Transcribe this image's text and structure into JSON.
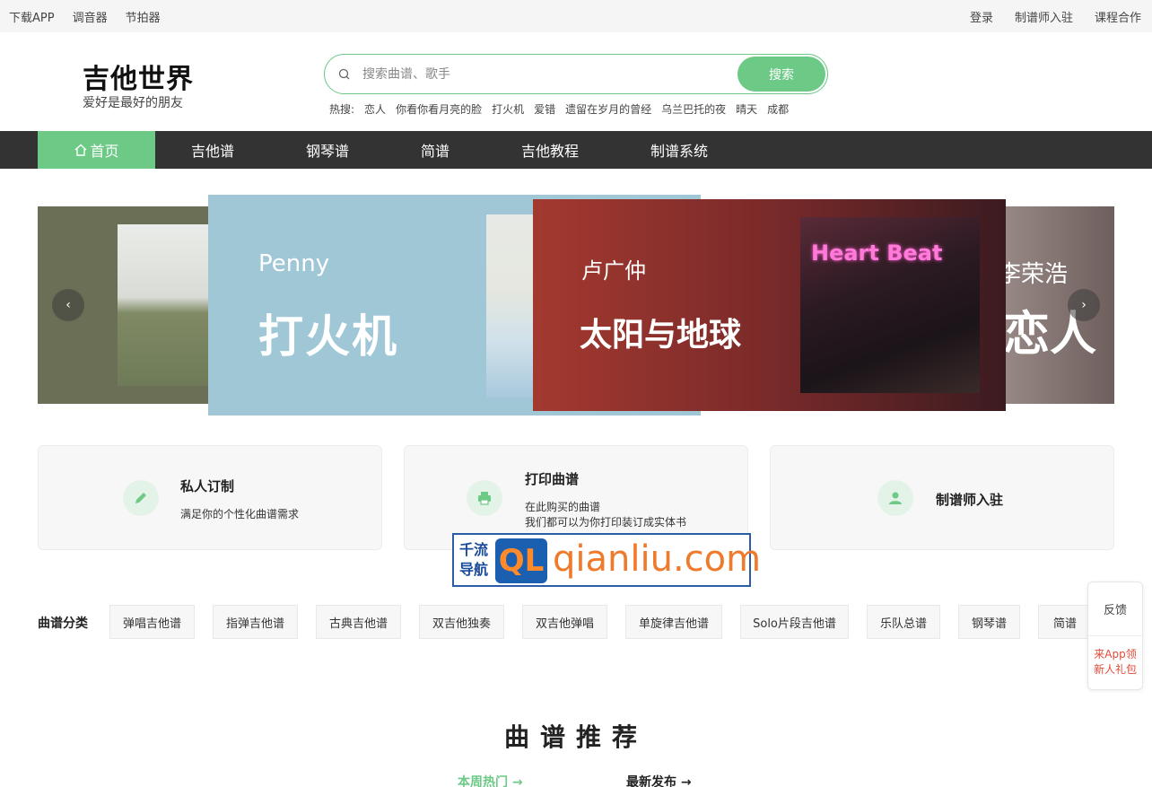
{
  "topbar": {
    "left": [
      "下载APP",
      "调音器",
      "节拍器"
    ],
    "right": [
      "登录",
      "制谱师入驻",
      "课程合作"
    ]
  },
  "header": {
    "logo": "吉他世界",
    "slogan": "爱好是最好的朋友",
    "search_placeholder": "搜索曲谱、歌手",
    "search_button": "搜索",
    "hot_label": "热搜:",
    "hot_items": [
      "恋人",
      "你看你看月亮的脸",
      "打火机",
      "爱错",
      "遗留在岁月的曾经",
      "乌兰巴托的夜",
      "晴天",
      "成都"
    ]
  },
  "nav": {
    "items": [
      "首页",
      "吉他谱",
      "钢琴谱",
      "简谱",
      "吉他教程",
      "制谱系统"
    ],
    "active": "首页"
  },
  "carousel": {
    "slides": [
      {
        "artist": "Penny",
        "song": "打火机"
      },
      {
        "artist": "卢广仲",
        "song": "太阳与地球"
      },
      {
        "artist": "李荣浩",
        "song": "恋人"
      }
    ],
    "neon_text": "Heart Beat"
  },
  "features": [
    {
      "title": "私人订制",
      "desc": [
        "满足你的个性化曲谱需求"
      ]
    },
    {
      "title": "打印曲谱",
      "desc": [
        "在此购买的曲谱",
        "我们都可以为你打印装订成实体书"
      ]
    },
    {
      "title": "制谱师入驻",
      "desc": []
    }
  ],
  "watermark": {
    "cn_line1": "千流",
    "cn_line2": "导航",
    "logo": "QL",
    "url": "qianliu.com"
  },
  "categories": {
    "label": "曲谱分类",
    "items": [
      "弹唱吉他谱",
      "指弹吉他谱",
      "古典吉他谱",
      "双吉他独奏",
      "双吉他弹唱",
      "单旋律吉他谱",
      "Solo片段吉他谱",
      "乐队总谱",
      "钢琴谱",
      "简谱"
    ]
  },
  "float": {
    "feedback": "反馈",
    "app_line1": "来App领",
    "app_line2": "新人礼包"
  },
  "recommend": {
    "title": "曲谱推荐",
    "tabs": [
      {
        "label": "本周热门 →",
        "active": true
      },
      {
        "label": "最新发布 →",
        "active": false
      }
    ]
  },
  "colors": {
    "accent": "#6cc986",
    "nav_bg": "#333333"
  }
}
